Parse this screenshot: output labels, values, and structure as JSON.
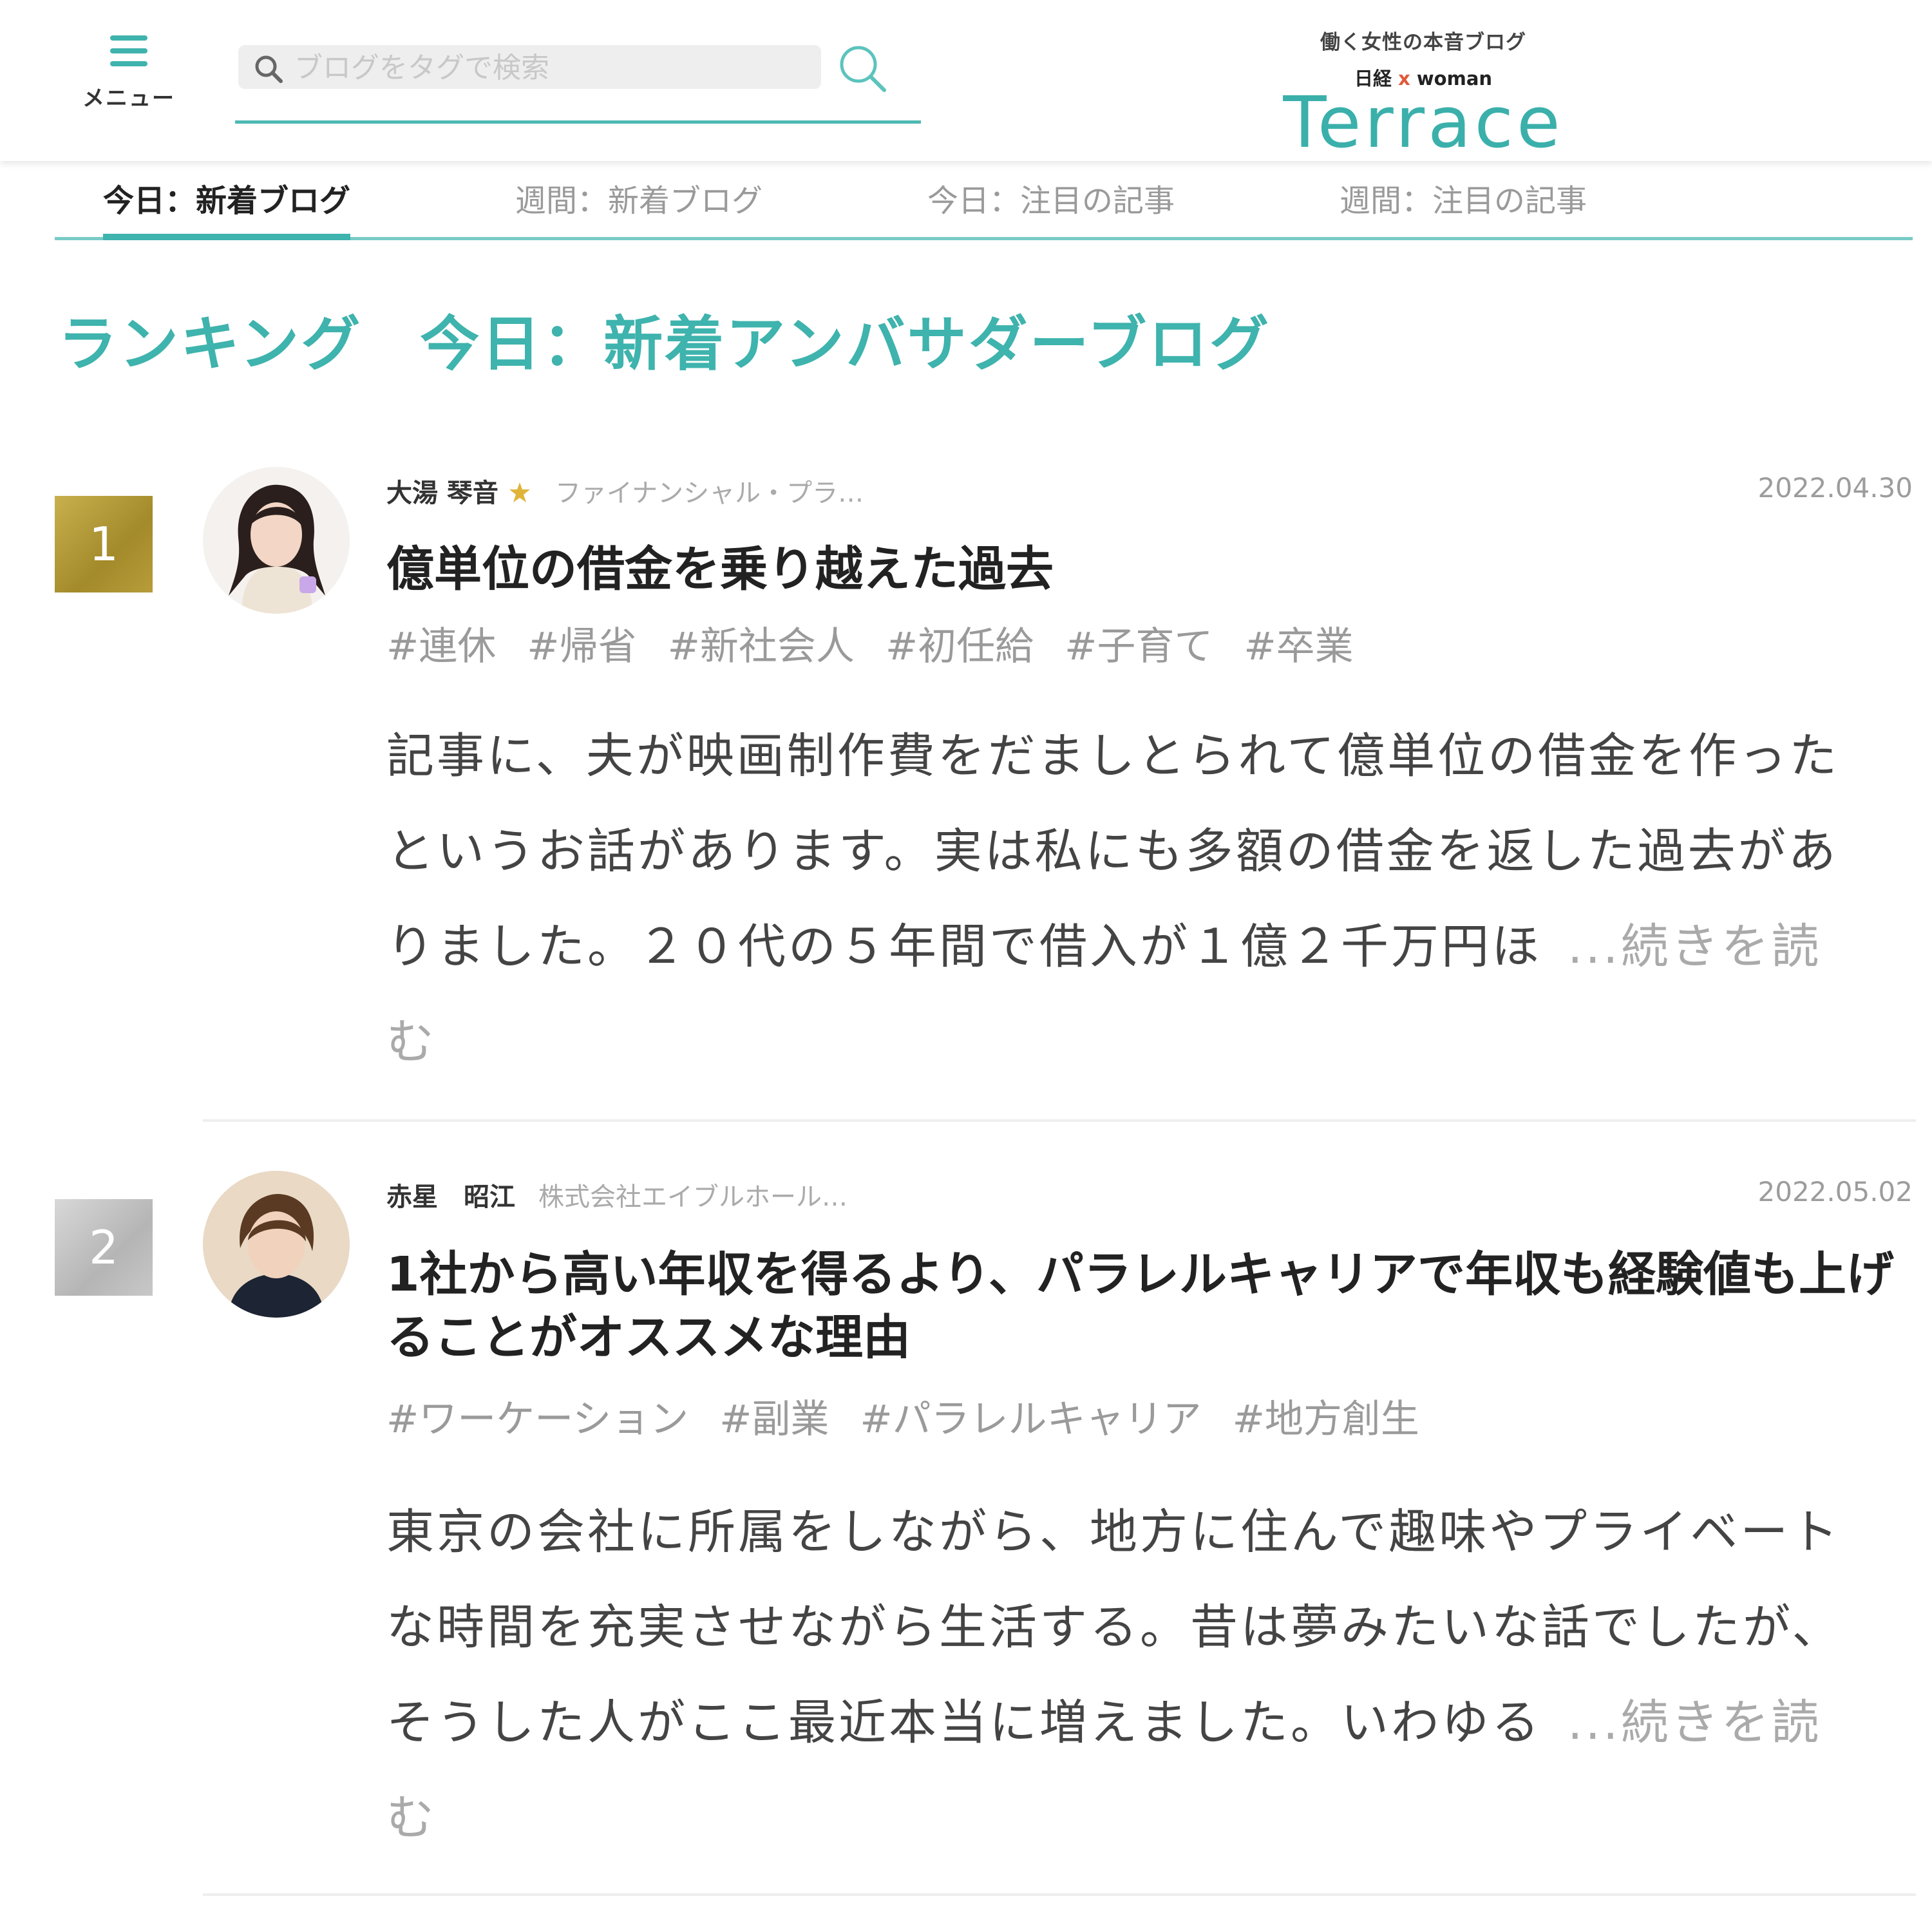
{
  "header": {
    "menu_label": "メニュー",
    "search_placeholder": "ブログをタグで検索",
    "logo_tagline": "働く女性の本音ブログ",
    "logo_brand_left": "日経",
    "logo_brand_x": "x",
    "logo_brand_right": "woman",
    "logo_name": "Terrace"
  },
  "tabs": [
    {
      "label": "今日：新着ブログ",
      "active": true
    },
    {
      "label": "週間：新着ブログ",
      "active": false
    },
    {
      "label": "今日：注目の記事",
      "active": false
    },
    {
      "label": "週間：注目の記事",
      "active": false
    }
  ],
  "section": {
    "title_left": "ランキング",
    "title_right": "今日：新着アンバサダーブログ"
  },
  "entries": [
    {
      "rank": "1",
      "author": "大湯 琴音",
      "author_title": "ファイナンシャル・プラ…",
      "date": "2022.04.30",
      "title": "億単位の借金を乗り越えた過去",
      "tags": [
        "#連休",
        "#帰省",
        "#新社会人",
        "#初任給",
        "#子育て",
        "#卒業"
      ],
      "excerpt": "記事に、夫が映画制作費をだましとられて億単位の借金を作ったというお話があります。実は私にも多額の借金を返した過去がありました。２０代の５年間で借入が１億２千万円ほ",
      "read_more": "...続きを読む"
    },
    {
      "rank": "2",
      "author": "赤星　昭江",
      "author_title": "株式会社エイブルホール…",
      "date": "2022.05.02",
      "title": "1社から高い年収を得るより、パラレルキャリアで年収も経験値も上げることがオススメな理由",
      "tags": [
        "#ワーケーション",
        "#副業",
        "#パラレルキャリア",
        "#地方創生"
      ],
      "excerpt": "東京の会社に所属をしながら、地方に住んで趣味やプライベートな時間を充実させながら生活する。昔は夢みたいな話でしたが、そうした人がここ最近本当に増えました。いわゆる",
      "read_more": "...続きを読む"
    }
  ],
  "colors": {
    "accent": "#3fb3ad",
    "gold": "#b39a38",
    "silver": "#c4c4c4"
  }
}
